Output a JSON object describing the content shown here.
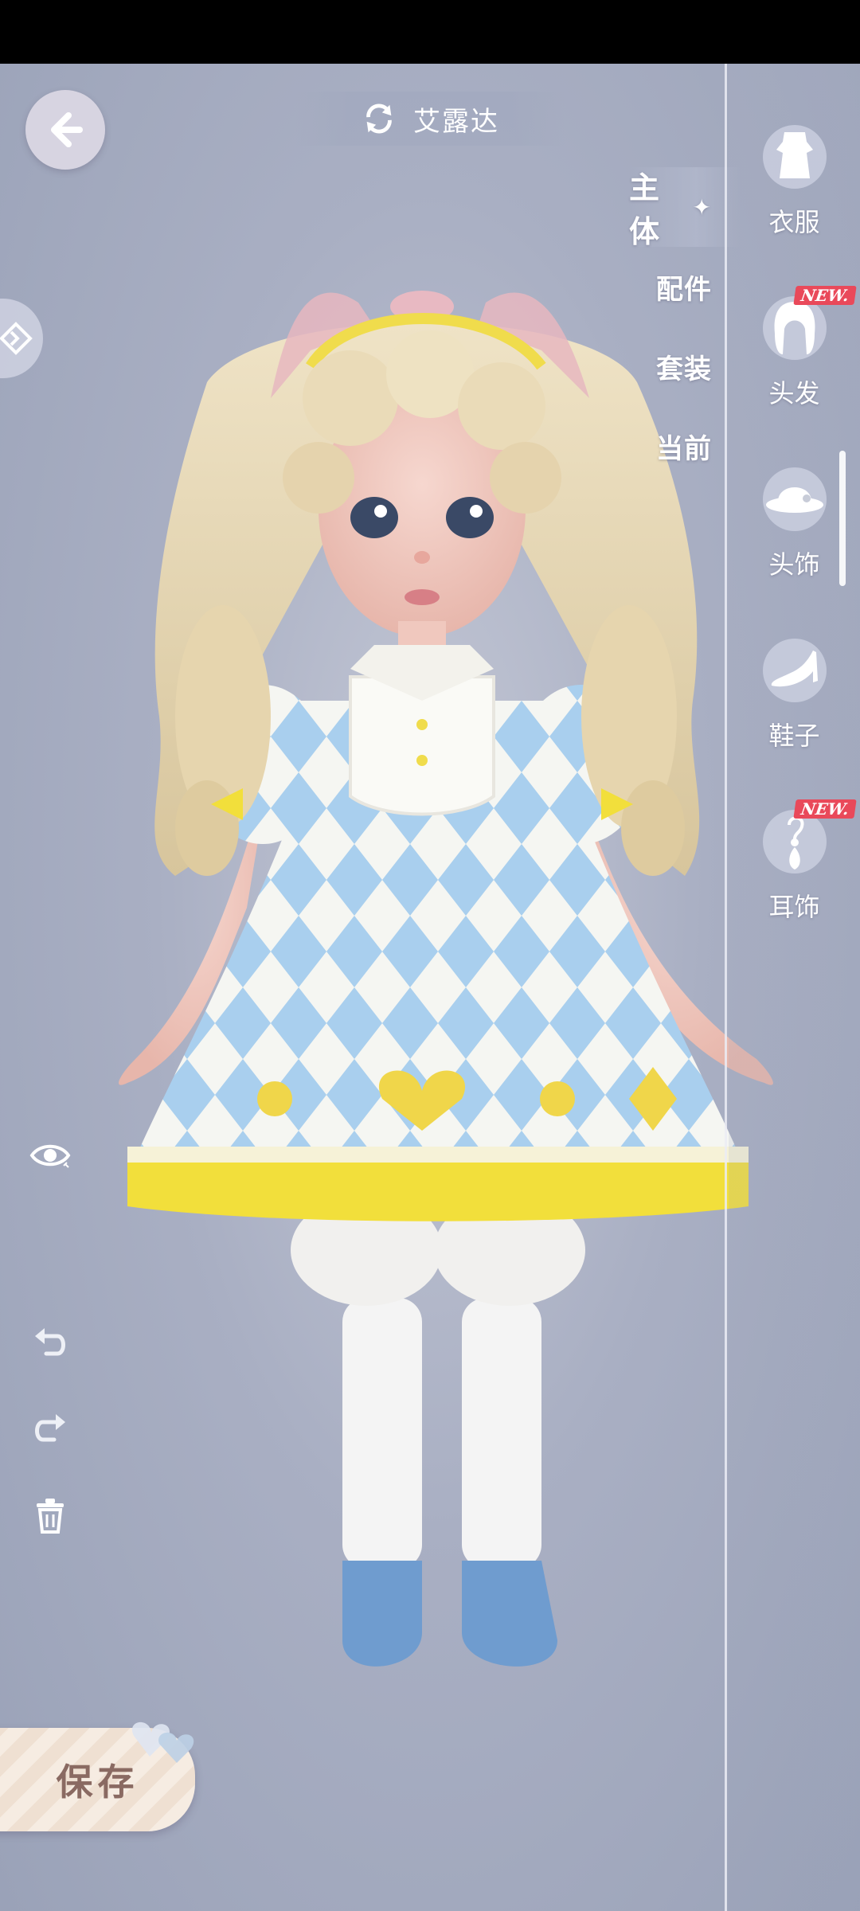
{
  "header": {
    "back_label": "",
    "character_name": "艾露达"
  },
  "category_tabs": [
    {
      "label": "主体",
      "active": true
    },
    {
      "label": "配件",
      "active": false
    },
    {
      "label": "套装",
      "active": false
    },
    {
      "label": "当前",
      "active": false
    }
  ],
  "slots": [
    {
      "label": "衣服",
      "icon": "dress-icon",
      "new": false
    },
    {
      "label": "头发",
      "icon": "hair-icon",
      "new": true
    },
    {
      "label": "头饰",
      "icon": "hat-icon",
      "new": false
    },
    {
      "label": "鞋子",
      "icon": "shoe-icon",
      "new": false
    },
    {
      "label": "耳饰",
      "icon": "earring-icon",
      "new": true
    }
  ],
  "new_badge_text": "NEW.",
  "tools": {
    "visibility_icon": "eye-icon",
    "undo_icon": "undo-icon",
    "redo_icon": "redo-icon",
    "delete_icon": "trash-icon"
  },
  "save_label": "保存",
  "colors": {
    "background": "#a9afc3",
    "dress_blue": "#a9cfee",
    "dress_yellow": "#f2df3b",
    "badge_red": "#e9495a",
    "save_text": "#8a6a62"
  }
}
